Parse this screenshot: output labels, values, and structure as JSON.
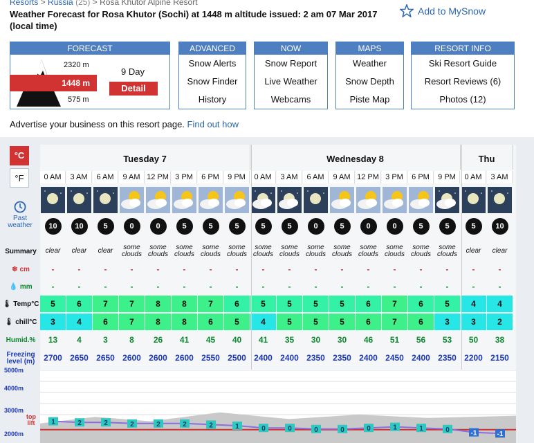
{
  "breadcrumb": {
    "resorts": "Resorts",
    "sep": ">",
    "country": "Russia",
    "country_count": "(25)",
    "resort": "Rosa Khutor Alpine Resort"
  },
  "title": "Weather Forecast for Rosa Khutor (Sochi) at 1448 m altitude issued: 2 am 07 Mar 2017 (local time)",
  "mysnow": "Add to MySnow",
  "nav": {
    "forecast": {
      "header": "FORECAST",
      "top": "2320 m",
      "mid": "1448 m",
      "bot": "575 m",
      "nineday": "9 Day",
      "detail": "Detail"
    },
    "advanced": {
      "header": "ADVANCED",
      "items": [
        "Snow Alerts",
        "Snow Finder",
        "History"
      ]
    },
    "now": {
      "header": "NOW",
      "items": [
        "Snow Report",
        "Live Weather",
        "Webcams"
      ]
    },
    "maps": {
      "header": "MAPS",
      "items": [
        "Weather",
        "Snow Depth",
        "Piste Map"
      ]
    },
    "info": {
      "header": "RESORT INFO",
      "items": [
        "Ski Resort Guide",
        "Resort Reviews (6)",
        "Photos (12)"
      ]
    }
  },
  "advert": {
    "text": "Advertise your business on this resort page.",
    "link": "Find out how"
  },
  "units": {
    "c": "°C",
    "f": "°F"
  },
  "past": {
    "text": "Past",
    "overlap": "weather"
  },
  "labels": {
    "summary": "Summary",
    "snow": "cm",
    "rain": "mm",
    "temp": "Temp°C",
    "chill": "chill°C",
    "humid": "Humid.%",
    "freezing": "Freezing level (m)"
  },
  "days": [
    {
      "label": "Tuesday 7",
      "cols": 8
    },
    {
      "label": "Wednesday 8",
      "cols": 8
    },
    {
      "label": "Thu",
      "cols": 2
    }
  ],
  "hours": [
    "0 AM",
    "3 AM",
    "6 AM",
    "9 AM",
    "12 PM",
    "3 PM",
    "6 PM",
    "9 PM",
    "0 AM",
    "3 AM",
    "6 AM",
    "9 AM",
    "12 PM",
    "3 PM",
    "6 PM",
    "9 PM",
    "0 AM",
    "3 AM"
  ],
  "weather_icons": [
    "night-clear",
    "night-clear",
    "night-clear",
    "sun-cloud",
    "sun-cloud",
    "sun-cloud",
    "sun-cloud",
    "cloud",
    "night-cloud",
    "night-cloud",
    "night-clear",
    "sun-cloud",
    "sun-cloud",
    "sun-cloud",
    "sun-cloud",
    "night-cloud",
    "night-clear",
    "night-clear"
  ],
  "wind": [
    "10",
    "10",
    "5",
    "0",
    "0",
    "5",
    "5",
    "5",
    "5",
    "5",
    "0",
    "5",
    "0",
    "0",
    "5",
    "5",
    "5",
    "10"
  ],
  "summary": [
    "clear",
    "clear",
    "clear",
    "some clouds",
    "some clouds",
    "some clouds",
    "some clouds",
    "some clouds",
    "some clouds",
    "some clouds",
    "some clouds",
    "some clouds",
    "some clouds",
    "some clouds",
    "some clouds",
    "some clouds",
    "clear",
    "clear"
  ],
  "snow": [
    "-",
    "-",
    "-",
    "-",
    "-",
    "-",
    "-",
    "-",
    "-",
    "-",
    "-",
    "-",
    "-",
    "-",
    "-",
    "-",
    "-",
    "-"
  ],
  "rain": [
    "-",
    "-",
    "-",
    "-",
    "-",
    "-",
    "-",
    "-",
    "-",
    "-",
    "-",
    "-",
    "-",
    "-",
    "-",
    "-",
    "-",
    "-"
  ],
  "temp": [
    "5",
    "6",
    "7",
    "7",
    "8",
    "8",
    "7",
    "6",
    "5",
    "5",
    "5",
    "5",
    "6",
    "7",
    "6",
    "5",
    "4",
    "4"
  ],
  "chill": [
    "3",
    "4",
    "6",
    "7",
    "8",
    "8",
    "6",
    "5",
    "4",
    "5",
    "5",
    "5",
    "6",
    "7",
    "6",
    "3",
    "3",
    "2"
  ],
  "humid": [
    "13",
    "4",
    "3",
    "8",
    "26",
    "41",
    "45",
    "40",
    "41",
    "35",
    "30",
    "30",
    "46",
    "51",
    "56",
    "53",
    "50",
    "38"
  ],
  "freezing": [
    "2700",
    "2650",
    "2650",
    "2600",
    "2600",
    "2600",
    "2550",
    "2500",
    "2400",
    "2400",
    "2350",
    "2350",
    "2400",
    "2450",
    "2400",
    "2350",
    "2200",
    "2150"
  ],
  "chart": {
    "ticks": [
      "5000m",
      "4000m",
      "3000m",
      "2000m"
    ],
    "top_lift": "top lift",
    "markers": [
      "1",
      "2",
      "2",
      "2",
      "2",
      "2",
      "2",
      "1",
      "0",
      "0",
      "0",
      "0",
      "0",
      "1",
      "1",
      "0",
      "-1",
      "-1"
    ]
  },
  "colors": {
    "accent": "#d13232",
    "nav": "#4d7fc1",
    "link": "#2a66b3",
    "green": "#0a8b2c",
    "blue": "#1c39bb"
  }
}
